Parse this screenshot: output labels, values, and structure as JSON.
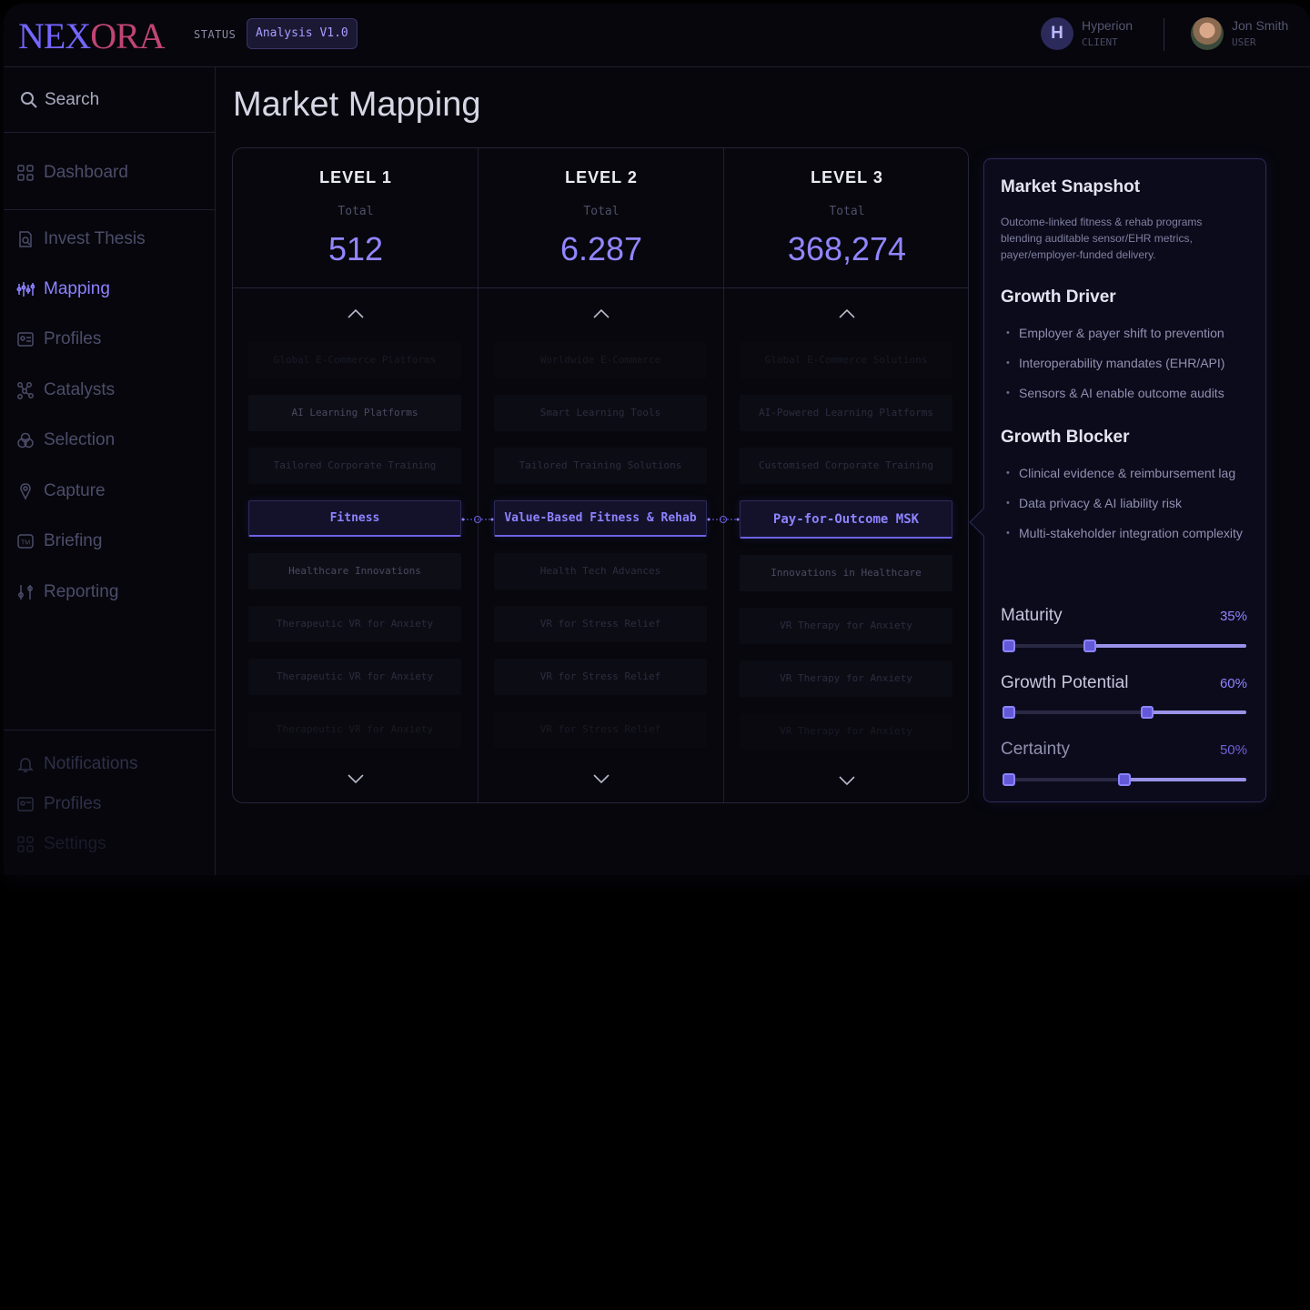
{
  "header": {
    "logo": {
      "part1": "NEX",
      "part2": "ORA"
    },
    "status_label": "STATUS",
    "status_value": "Analysis V1.0",
    "client": {
      "initial": "H",
      "name": "Hyperion",
      "role": "CLIENT"
    },
    "user": {
      "name": "Jon Smith",
      "role": "USER"
    }
  },
  "sidebar": {
    "search_label": "Search",
    "dashboard": "Dashboard",
    "items": [
      {
        "label": "Invest Thesis",
        "icon": "doc-search-icon"
      },
      {
        "label": "Mapping",
        "icon": "mapping-icon",
        "active": true
      },
      {
        "label": "Profiles",
        "icon": "profile-card-icon"
      },
      {
        "label": "Catalysts",
        "icon": "catalysts-icon"
      },
      {
        "label": "Selection",
        "icon": "selection-icon"
      },
      {
        "label": "Capture",
        "icon": "capture-icon"
      },
      {
        "label": "Briefing",
        "icon": "briefing-icon"
      },
      {
        "label": "Reporting",
        "icon": "reporting-icon"
      }
    ],
    "bottom": [
      {
        "label": "Notifications",
        "icon": "bell-icon"
      },
      {
        "label": "Profiles",
        "icon": "profile-card-icon"
      },
      {
        "label": "Settings",
        "icon": "grid-icon"
      }
    ]
  },
  "main": {
    "title": "Market Mapping",
    "total_label": "Total",
    "columns": [
      {
        "level": "LEVEL 1",
        "total": "512",
        "items": [
          "Global E-Commerce Platforms",
          "AI Learning Platforms",
          "Tailored Corporate Training",
          "Fitness",
          "Healthcare Innovations",
          "Therapeutic VR for Anxiety",
          "Therapeutic VR for Anxiety",
          "Therapeutic VR for Anxiety"
        ]
      },
      {
        "level": "LEVEL 2",
        "total": "6.287",
        "items": [
          "Worldwide E-Commerce",
          "Smart Learning Tools",
          "Tailored Training Solutions",
          "Value-Based Fitness & Rehab",
          "Health Tech Advances",
          "VR for Stress Relief",
          "VR for Stress Relief",
          "VR for Stress Relief"
        ]
      },
      {
        "level": "LEVEL 3",
        "total": "368,274",
        "items": [
          "Global E-Commerce Solutions",
          "AI-Powered Learning Platforms",
          "Customised Corporate Training",
          "Pay-for-Outcome MSK",
          "Innovations in Healthcare",
          "VR Therapy for Anxiety",
          "VR Therapy for Anxiety",
          "VR Therapy for Anxiety"
        ]
      }
    ]
  },
  "snapshot": {
    "title": "Market Snapshot",
    "description": "Outcome-linked fitness & rehab programs blending auditable sensor/EHR metrics, payer/employer-funded delivery.",
    "driver_title": "Growth Driver",
    "drivers": [
      "Employer & payer shift to prevention",
      "Interoperability mandates (EHR/API)",
      "Sensors & AI enable outcome audits"
    ],
    "blocker_title": "Growth Blocker",
    "blockers": [
      "Clinical evidence & reimbursement lag",
      "Data privacy & AI liability risk",
      "Multi-stakeholder integration complexity"
    ],
    "metrics": [
      {
        "label": "Maturity",
        "value": "35%",
        "fraction": 0.35
      },
      {
        "label": "Growth Potential",
        "value": "60%",
        "fraction": 0.6
      },
      {
        "label": "Certainty",
        "value": "50%",
        "fraction": 0.5
      }
    ]
  },
  "colors": {
    "accent": "#8d82ff",
    "brand_blue": "#7466ff",
    "brand_red": "#c14574",
    "background": "#06060c"
  }
}
